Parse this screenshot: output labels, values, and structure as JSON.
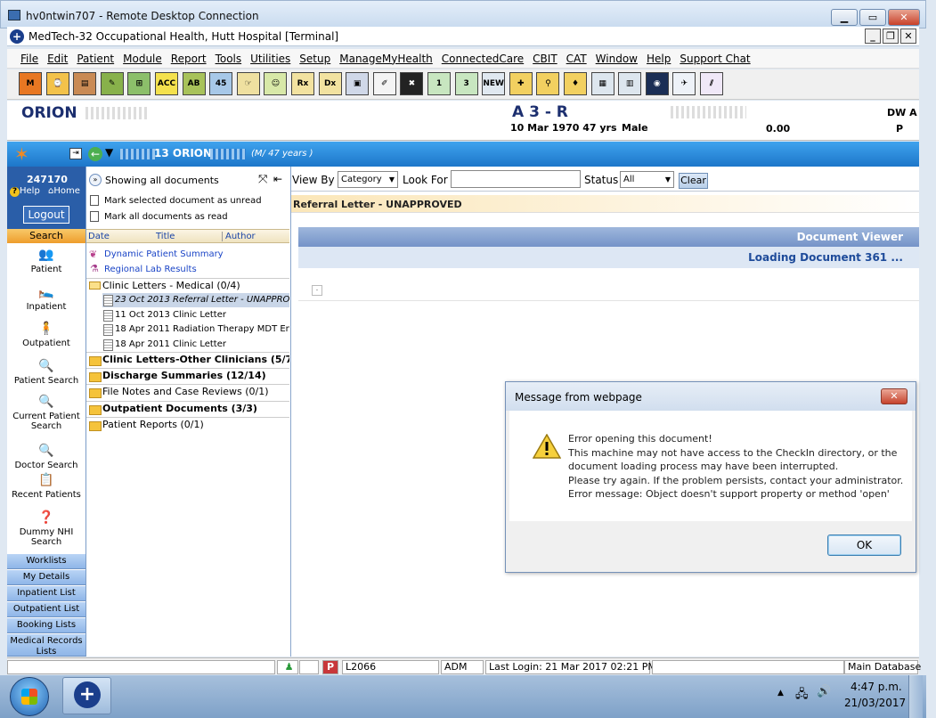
{
  "rdp": {
    "title": "hv0ntwin707 - Remote Desktop Connection"
  },
  "app": {
    "title": "MedTech-32  Occupational Health, Hutt Hospital  [Terminal]"
  },
  "menu": [
    "File",
    "Edit",
    "Patient",
    "Module",
    "Report",
    "Tools",
    "Utilities",
    "Setup",
    "ManageMyHealth",
    "ConnectedCare",
    "CBIT",
    "CAT",
    "Window",
    "Help",
    "Support Chat"
  ],
  "toolbar": [
    {
      "label": "M",
      "color": "#e87722"
    },
    {
      "label": "⌚",
      "color": "#f3c24a"
    },
    {
      "label": "▤",
      "color": "#c98a54"
    },
    {
      "label": "✎",
      "color": "#88b14b"
    },
    {
      "label": "⊞",
      "color": "#8cbf6a"
    },
    {
      "label": "ACC",
      "color": "#f4e14d"
    },
    {
      "label": "AB",
      "color": "#a8c25a"
    },
    {
      "label": "45",
      "color": "#a7c8e8"
    },
    {
      "label": "☞",
      "color": "#efe0a0"
    },
    {
      "label": "☺",
      "color": "#d8e8a8"
    },
    {
      "label": "Rx",
      "color": "#f2e2a0"
    },
    {
      "label": "Dx",
      "color": "#f2e2a0"
    },
    {
      "label": "▣",
      "color": "#d0d8e8"
    },
    {
      "label": "✐",
      "color": "#f4f4f4"
    },
    {
      "label": "✖",
      "color": "#222"
    },
    {
      "label": "1",
      "color": "#c8e6c0"
    },
    {
      "label": "3",
      "color": "#c8e6c0"
    },
    {
      "label": "NEW",
      "color": "#e0e8f0"
    },
    {
      "label": "✚",
      "color": "#f2d060"
    },
    {
      "label": "⚲",
      "color": "#f2d060"
    },
    {
      "label": "♦",
      "color": "#f2d060"
    },
    {
      "label": "▦",
      "color": "#dde6ee"
    },
    {
      "label": "▥",
      "color": "#dde6ee"
    },
    {
      "label": "◉",
      "color": "#1b2e55"
    },
    {
      "label": "✈",
      "color": "#eef2f8"
    },
    {
      "label": "⫽",
      "color": "#f0e8f8"
    }
  ],
  "patient": {
    "name": "ORION",
    "code": "A 3 - R",
    "dob": "10 Mar 1970 47 yrs",
    "sex": "Male",
    "balance": "0.00",
    "right1": "DW A",
    "right2": "P"
  },
  "bluebar": {
    "text": "13 ORION",
    "sub": "(M/ 47 years )"
  },
  "sidebar": {
    "user_id": "247170",
    "help": "Help",
    "home": "Home",
    "logout": "Logout",
    "search": "Search",
    "items": [
      "Patient",
      "Inpatient",
      "Outpatient",
      "Patient Search",
      "Current Patient Search",
      "Doctor Search",
      "Recent Patients",
      "Dummy NHI Search"
    ],
    "lists": [
      "Worklists",
      "My Details",
      "Inpatient List",
      "Outpatient List",
      "Booking Lists",
      "Medical Records Lists"
    ]
  },
  "doclist": {
    "showing": "Showing all documents",
    "mark_unread": "Mark selected document as unread",
    "mark_read": "Mark all documents as read",
    "columns": [
      "Date",
      "Title",
      "Author"
    ],
    "links": [
      "Dynamic Patient Summary",
      "Regional Lab Results"
    ],
    "folder1": "Clinic Letters - Medical",
    "folder1_count": "(0/4)",
    "docs": [
      "23 Oct 2013 Referral Letter - UNAPPRO",
      "11 Oct 2013 Clinic Letter",
      "18 Apr 2011 Radiation Therapy MDT End",
      "18 Apr 2011 Clinic Letter"
    ],
    "folders": [
      {
        "name": "Clinic Letters-Other Clinicians (5/7)",
        "bold": true
      },
      {
        "name": "Discharge Summaries (12/14)",
        "bold": true
      },
      {
        "name": "File Notes and Case Reviews (0/1)",
        "bold": false
      },
      {
        "name": "Outpatient Documents (3/3)",
        "bold": true
      },
      {
        "name": "Patient Reports (0/1)",
        "bold": false
      }
    ]
  },
  "filter": {
    "view_by": "View By",
    "category": "Category",
    "look_for": "Look For",
    "status": "Status",
    "all": "All",
    "clear": "Clear"
  },
  "main": {
    "doc_title": "Referral Letter - UNAPPROVED",
    "viewer": "Document Viewer",
    "loading": "Loading Document 361 ..."
  },
  "dialog": {
    "title": "Message from webpage",
    "lines": [
      "Error opening this document!",
      "This machine may not have access to the CheckIn directory, or the",
      "document loading process may have been interrupted.",
      "Please try again. If the problem persists, contact your administrator.",
      "Error message: Object doesn't support property or method 'open'"
    ],
    "ok": "OK"
  },
  "status": {
    "p": "P",
    "code": "L2066",
    "user": "ADM",
    "login": "Last Login: 21 Mar 2017 02:21 PM",
    "db": "Main Database"
  },
  "taskbar": {
    "time": "4:47 p.m.",
    "date": "21/03/2017"
  }
}
